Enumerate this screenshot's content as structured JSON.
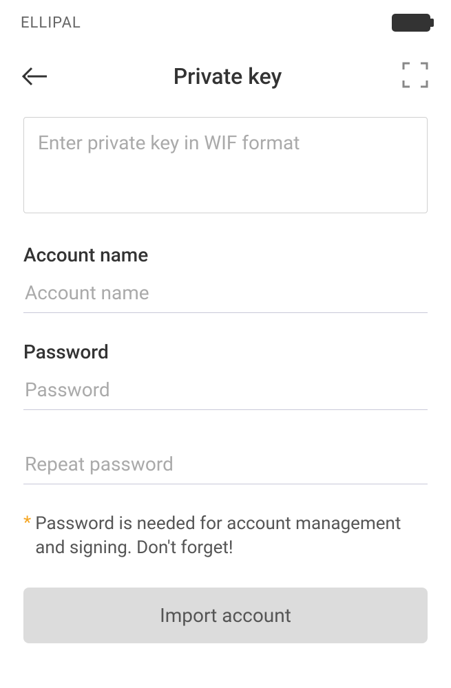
{
  "statusBar": {
    "deviceName": "ELLIPAL"
  },
  "header": {
    "title": "Private key"
  },
  "form": {
    "privateKey": {
      "placeholder": "Enter private key in WIF format"
    },
    "accountName": {
      "label": "Account name",
      "placeholder": "Account name"
    },
    "password": {
      "label": "Password",
      "placeholder": "Password"
    },
    "repeatPassword": {
      "placeholder": "Repeat password"
    },
    "hint": {
      "marker": "*",
      "text": "Password is needed for account management and signing. Don't forget!"
    },
    "submitLabel": "Import account"
  }
}
